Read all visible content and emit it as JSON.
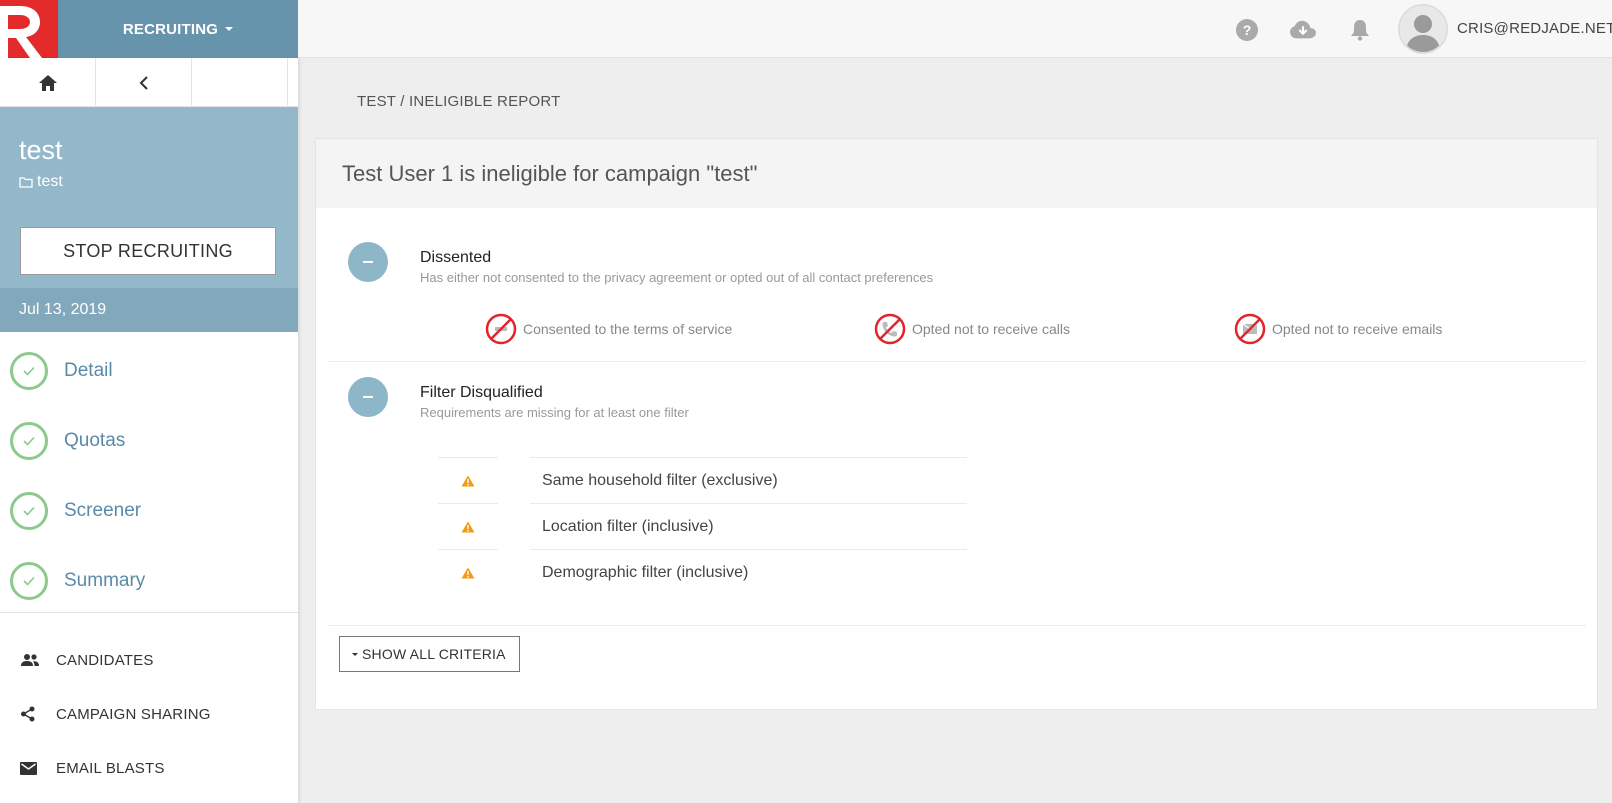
{
  "header": {
    "module_label": "RECRUITING",
    "user_email": "CRIS@REDJADE.NET",
    "icons": [
      "help-icon",
      "cloud-download-icon",
      "bell-icon",
      "avatar"
    ]
  },
  "sidebar": {
    "campaign_name": "test",
    "folder_name": "test",
    "stop_button_label": "STOP RECRUITING",
    "date": "Jul 13, 2019",
    "steps": [
      {
        "label": "Detail"
      },
      {
        "label": "Quotas"
      },
      {
        "label": "Screener"
      },
      {
        "label": "Summary"
      }
    ],
    "links": [
      {
        "label": "CANDIDATES"
      },
      {
        "label": "CAMPAIGN SHARING"
      },
      {
        "label": "EMAIL BLASTS"
      }
    ]
  },
  "main": {
    "breadcrumb": "TEST / INELIGIBLE REPORT",
    "panel_title": "Test User 1 is ineligible for campaign \"test\"",
    "reasons": [
      {
        "title": "Dissented",
        "description": "Has either not consented to the privacy agreement or opted out of all contact preferences",
        "items": [
          {
            "label": "Consented to the terms of service"
          },
          {
            "label": "Opted not to receive calls"
          },
          {
            "label": "Opted not to receive emails"
          }
        ]
      },
      {
        "title": "Filter Disqualified",
        "description": "Requirements are missing for at least one filter",
        "filters": [
          {
            "label": "Same household filter (exclusive)"
          },
          {
            "label": "Location filter (inclusive)"
          },
          {
            "label": "Demographic filter (inclusive)"
          }
        ]
      }
    ],
    "show_all_label": "SHOW ALL CRITERIA"
  },
  "colors": {
    "brand_red": "#e32b2b",
    "module_blue": "#6794ad",
    "campaign_blue": "#92b8ca",
    "check_green": "#8bc98d",
    "warning_orange": "#f39c12"
  }
}
